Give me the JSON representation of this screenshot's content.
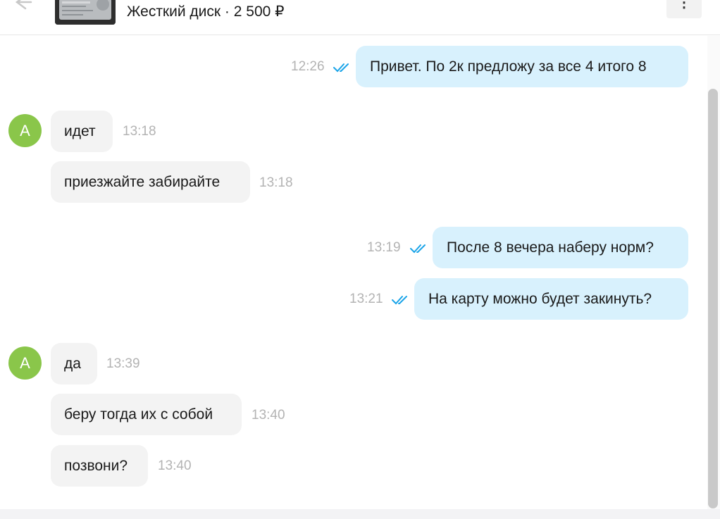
{
  "header": {
    "back_icon": "back-arrow-icon",
    "product_title": "Жесткий диск · 2 500 ₽",
    "menu_icon": "more-vertical-icon",
    "menu_symbol": "⋮"
  },
  "colors": {
    "outgoing_bubble": "#d8f1fd",
    "incoming_bubble": "#f3f3f3",
    "avatar": "#8ac64a",
    "read_check": "#1aa4e8",
    "timestamp": "#b3b3b3"
  },
  "avatar_letter": "A",
  "messages": [
    {
      "direction": "out",
      "text": "Привет. По 2к предложу за все 4 итого 8",
      "time": "12:26",
      "status": "read"
    },
    {
      "direction": "in",
      "text": "идет",
      "time": "13:18"
    },
    {
      "direction": "in",
      "text": "приезжайте забирайте",
      "time": "13:18"
    },
    {
      "direction": "out",
      "text": "После 8 вечера наберу норм?",
      "time": "13:19",
      "status": "read"
    },
    {
      "direction": "out",
      "text": "На карту можно будет закинуть?",
      "time": "13:21",
      "status": "read"
    },
    {
      "direction": "in",
      "text": "да",
      "time": "13:39"
    },
    {
      "direction": "in",
      "text": "беру тогда их с собой",
      "time": "13:40"
    },
    {
      "direction": "in",
      "text": "позвони?",
      "time": "13:40"
    }
  ]
}
